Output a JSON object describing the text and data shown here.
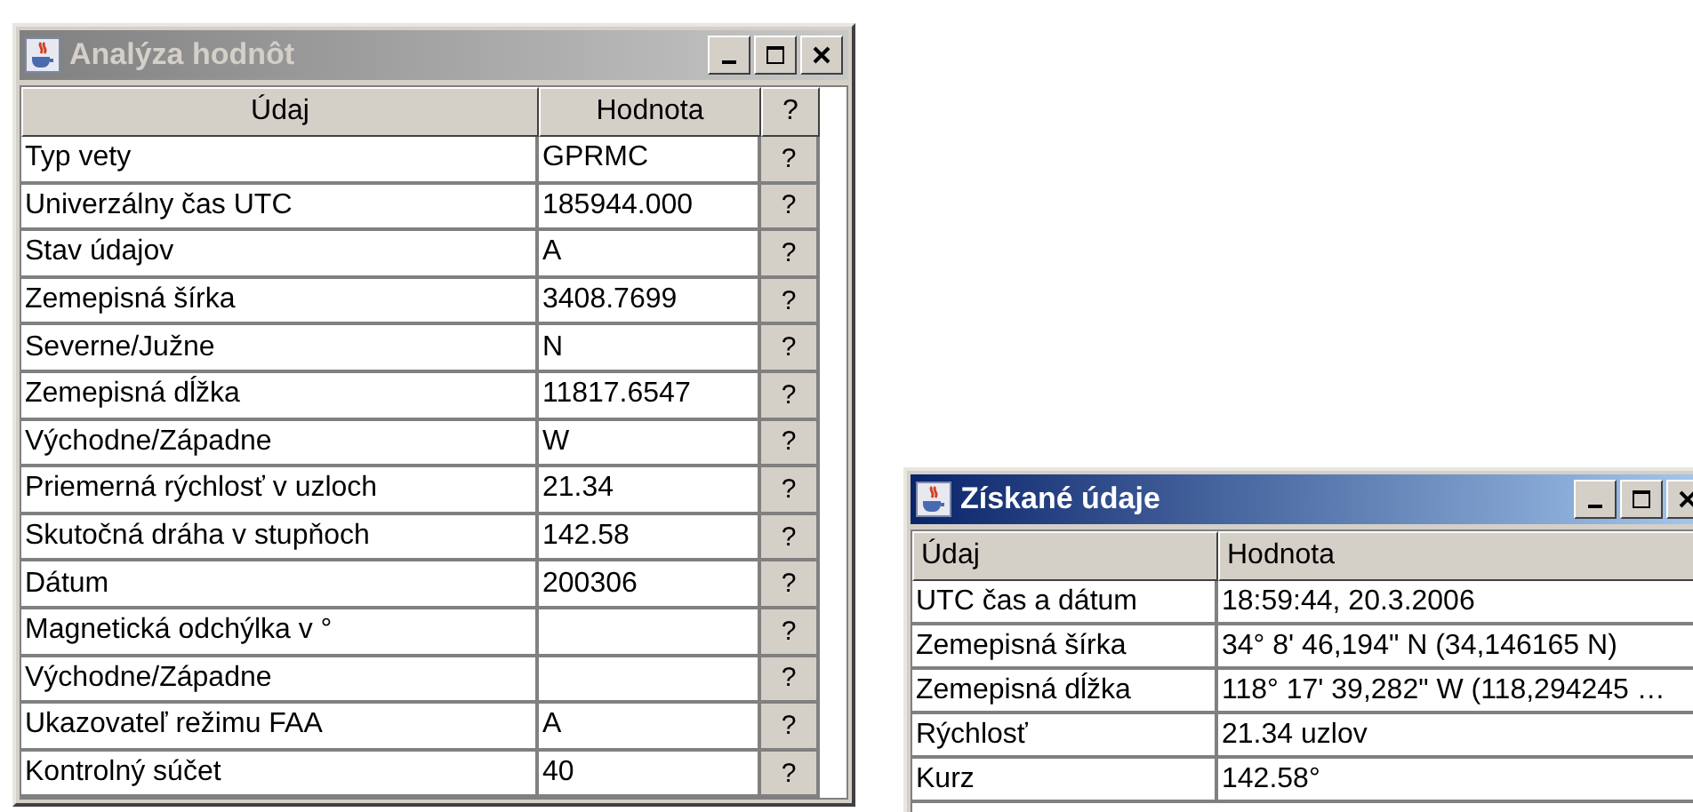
{
  "windows": [
    {
      "title": "Analýza hodnôt",
      "active": false,
      "columns": [
        {
          "label": "Údaj",
          "kind": "text"
        },
        {
          "label": "Hodnota",
          "kind": "text"
        },
        {
          "label": "?",
          "kind": "button"
        }
      ],
      "rows": [
        [
          "Typ vety",
          "GPRMC",
          "?"
        ],
        [
          "Univerzálny čas UTC",
          "185944.000",
          "?"
        ],
        [
          "Stav údajov",
          "A",
          "?"
        ],
        [
          "Zemepisná šírka",
          "3408.7699",
          "?"
        ],
        [
          "Severne/Južne",
          "N",
          "?"
        ],
        [
          "Zemepisná dĺžka",
          "11817.6547",
          "?"
        ],
        [
          "Východne/Západne",
          "W",
          "?"
        ],
        [
          "Priemerná rýchlosť v uzloch",
          "21.34",
          "?"
        ],
        [
          "Skutočná dráha v stupňoch",
          "142.58",
          "?"
        ],
        [
          "Dátum",
          "200306",
          "?"
        ],
        [
          "Magnetická odchýlka v °",
          null,
          "?"
        ],
        [
          "Východne/Západne",
          null,
          "?"
        ],
        [
          "Ukazovateľ režimu FAA",
          "A",
          "?"
        ],
        [
          "Kontrolný súčet",
          "40",
          "?"
        ]
      ]
    },
    {
      "title": "Získané údaje",
      "active": true,
      "columns": [
        {
          "label": "Údaj",
          "kind": "text"
        },
        {
          "label": "Hodnota",
          "kind": "text"
        }
      ],
      "rows": [
        [
          "UTC čas a dátum",
          "18:59:44, 20.3.2006"
        ],
        [
          "Zemepisná šírka",
          "34° 8' 46,194\" N (34,146165 N)"
        ],
        [
          "Zemepisná dĺžka",
          "118° 17' 39,282\" W (118,294245 …"
        ],
        [
          "Rýchlosť",
          "21.34 uzlov"
        ],
        [
          "Kurz",
          "142.58°"
        ]
      ]
    }
  ]
}
